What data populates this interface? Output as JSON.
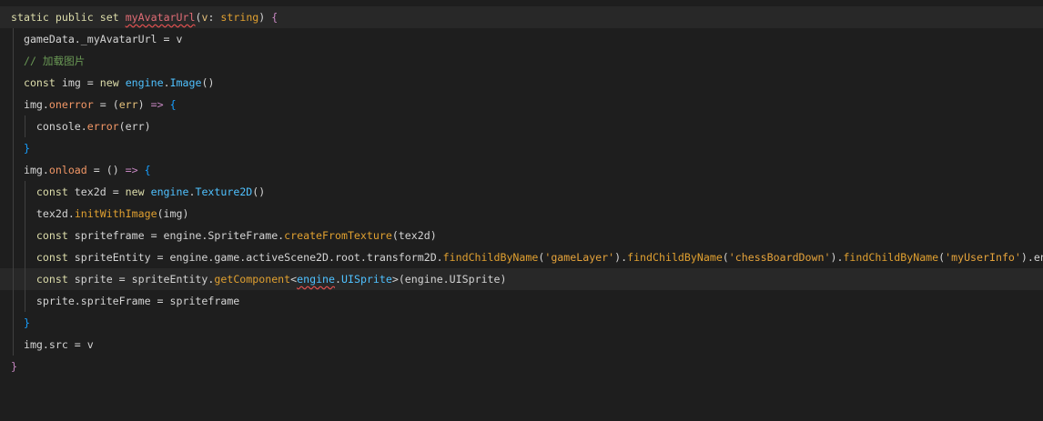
{
  "code": {
    "lines": [
      "static public set myAvatarUrl(v: string) {",
      "  gameData._myAvatarUrl = v",
      "  // 加载图片",
      "  const img = new engine.Image()",
      "  img.onerror = (err) => {",
      "    console.error(err)",
      "  }",
      "  img.onload = () => {",
      "    const tex2d = new engine.Texture2D()",
      "    tex2d.initWithImage(img)",
      "    const spriteframe = engine.SpriteFrame.createFromTexture(tex2d)",
      "    const spriteEntity = engine.game.activeScene2D.root.transform2D.findChildByName('gameLayer').findChildByName('chessBoardDown').findChildByName('myUserInfo').entity",
      "    const sprite = spriteEntity.getComponent<engine.UISprite>(engine.UISprite)",
      "    sprite.spriteFrame = spriteframe",
      "  }",
      "  img.src = v",
      "}"
    ],
    "highlighted_lines": [
      0,
      12
    ]
  },
  "colors": {
    "background": "#1e1e1e",
    "current_line": "#282828",
    "keyword": "#dcdcaa",
    "string": "#e5a33b",
    "comment": "#6a9955",
    "class": "#4fc1ff",
    "method": "#e0a030",
    "property": "#f29766",
    "error_squiggle": "#e05050"
  }
}
